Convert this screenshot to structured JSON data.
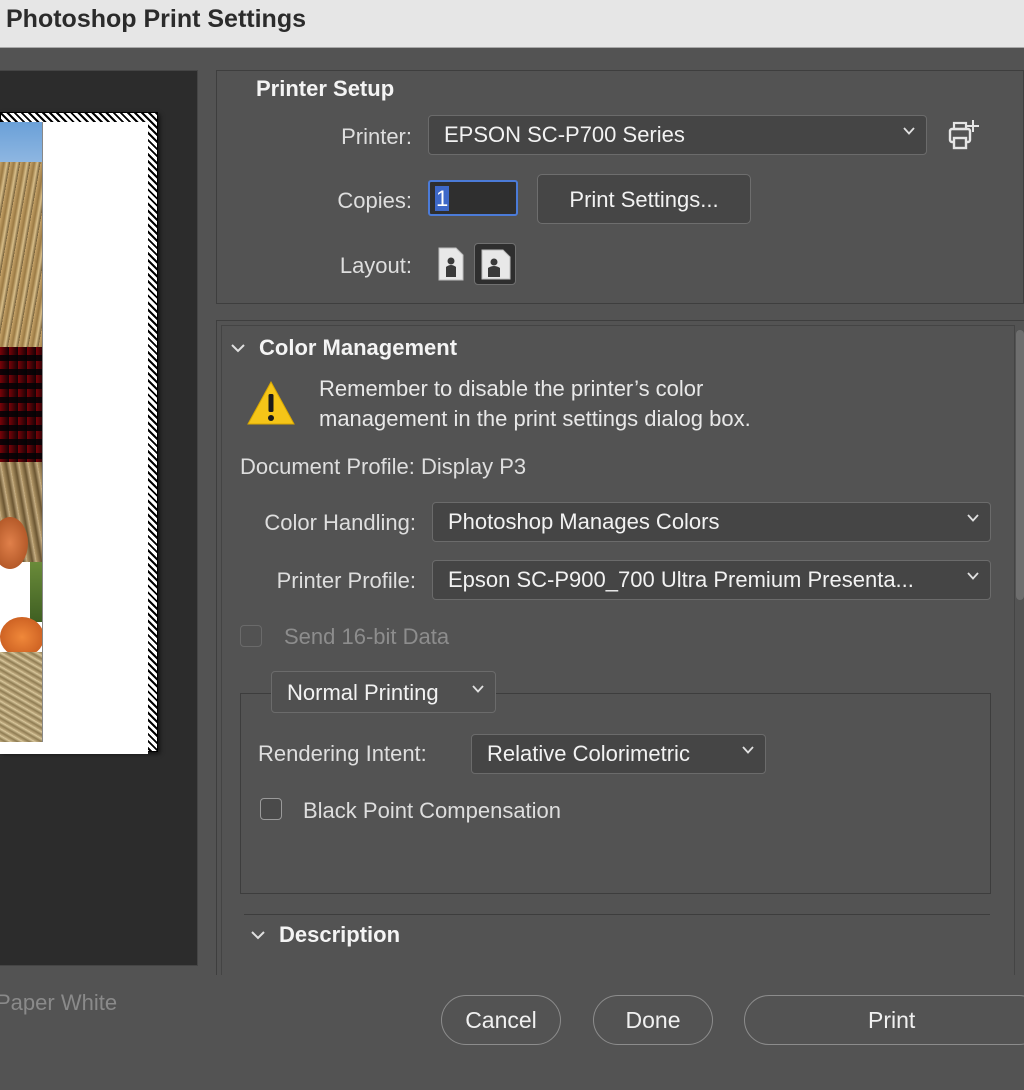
{
  "window": {
    "title": "Photoshop Print Settings"
  },
  "preview": {
    "paper_white_label": "Paper White"
  },
  "printer_setup": {
    "heading": "Printer Setup",
    "printer_label": "Printer:",
    "printer_value": "EPSON SC-P700 Series",
    "copies_label": "Copies:",
    "copies_value": "1",
    "print_settings_button": "Print Settings...",
    "layout_label": "Layout:"
  },
  "color_management": {
    "heading": "Color Management",
    "warning_line1": "Remember to disable the printer’s color",
    "warning_line2": "management in the print settings dialog box.",
    "document_profile": "Document Profile: Display P3",
    "color_handling_label": "Color Handling:",
    "color_handling_value": "Photoshop Manages Colors",
    "printer_profile_label": "Printer Profile:",
    "printer_profile_value": "Epson SC-P900_700 Ultra Premium Presenta...",
    "send_16bit_label": "Send 16-bit Data",
    "printing_mode_value": "Normal Printing",
    "rendering_intent_label": "Rendering Intent:",
    "rendering_intent_value": "Relative Colorimetric",
    "black_point_label": "Black Point Compensation"
  },
  "description": {
    "heading": "Description"
  },
  "footer": {
    "cancel": "Cancel",
    "done": "Done",
    "print": "Print"
  },
  "colors": {
    "background": "#535353",
    "titlebar": "#e6e6e6",
    "focus_ring": "#4b7bd8",
    "warning": "#f5c518"
  }
}
